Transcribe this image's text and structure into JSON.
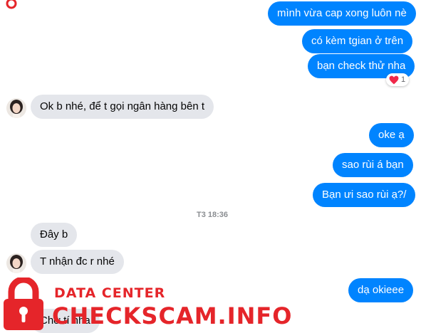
{
  "messages": {
    "m1": "mình vừa cap xong luôn nè",
    "m2": "có kèm tgian ở trên",
    "m3": "bạn check thử nha",
    "m4": "Ok b nhé, để t gọi ngân hàng bên t",
    "m5": "oke ạ",
    "m6": "sao rùi á bạn",
    "m7": "Bạn ưi sao rùi ạ?/",
    "m8": "Đây b",
    "m9": "T nhận đc r nhé",
    "m10": "dạ okieee",
    "m11": "Chờ tí nha"
  },
  "reaction": {
    "emoji": "heart-icon",
    "count": "1"
  },
  "timestamp": "T3 18:36",
  "watermark": {
    "line1": "DATA CENTER",
    "line2": "CHECKSCAM.INFO"
  },
  "colors": {
    "outgoing": "#0084ff",
    "incoming": "#e4e6eb",
    "watermark": "#e5252a"
  }
}
